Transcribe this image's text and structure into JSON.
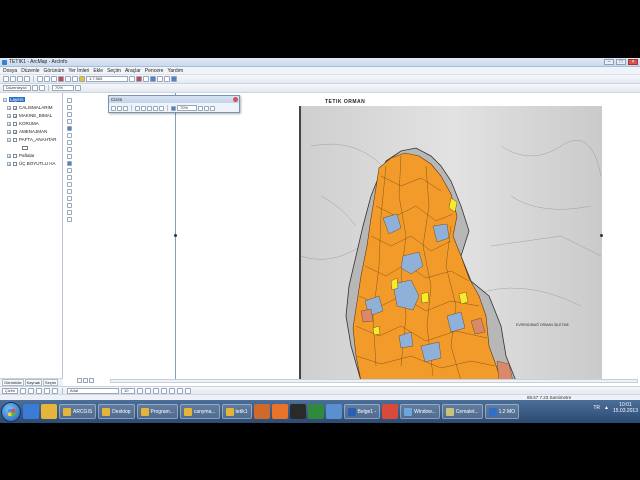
{
  "window": {
    "title": "TETIK1 - ArcMap - ArcInfo"
  },
  "menu": [
    "Dosya",
    "Düzenle",
    "Görünüm",
    "Yer İmleri",
    "Ekle",
    "Seçim",
    "Araçlar",
    "Pencere",
    "Yardım"
  ],
  "toolbar": {
    "scale_value": "1:7.565",
    "editor_label": "Düzenleyici",
    "zoom_value": "70%"
  },
  "toc": {
    "root_label": "Layers",
    "layers": [
      {
        "label": "CALISMALARIM",
        "checked": true
      },
      {
        "label": "MAKINE_BIMAL",
        "checked": true
      },
      {
        "label": "KORUMA",
        "checked": false
      },
      {
        "label": "AMENAJMAN",
        "checked": true
      },
      {
        "label": "PAFTA_ANAHTAR",
        "checked": false
      },
      {
        "label": "Paftalar",
        "checked": false
      },
      {
        "label": "ÜÇ BOYUTLU HA",
        "checked": false
      }
    ],
    "tabs": [
      "Görüntüle",
      "Kaynak",
      "Seçim"
    ]
  },
  "float_toolbar": {
    "title": "Cizim",
    "zoom_value": "70%"
  },
  "map": {
    "title": "TETIK ORMAN",
    "annotation": "EVRENDIBAĞ ORMAN İŞLETME"
  },
  "drawbar": {
    "draw_label": "Çizim",
    "font_value": "Arial",
    "size_value": "10"
  },
  "status": {
    "coords": "88.57  7.23 Santimetre"
  },
  "taskbar": {
    "tasks": [
      "ARCGIS",
      "Desktop",
      "Program...",
      "canyma...",
      "tetik1",
      "",
      "",
      "",
      "",
      "Belge1 -",
      "",
      "Window...",
      "Cemalet...",
      "1.2 MO"
    ],
    "lang": "TR",
    "time": "10:01",
    "date": "15.03.2013"
  },
  "colors": {
    "stand_orange": "#f29b2a",
    "stand_blue": "#8fb0d8",
    "stand_yellow": "#f4ec2c",
    "stand_salmon": "#d7896a",
    "scan_gray": "#d9d9d9"
  }
}
